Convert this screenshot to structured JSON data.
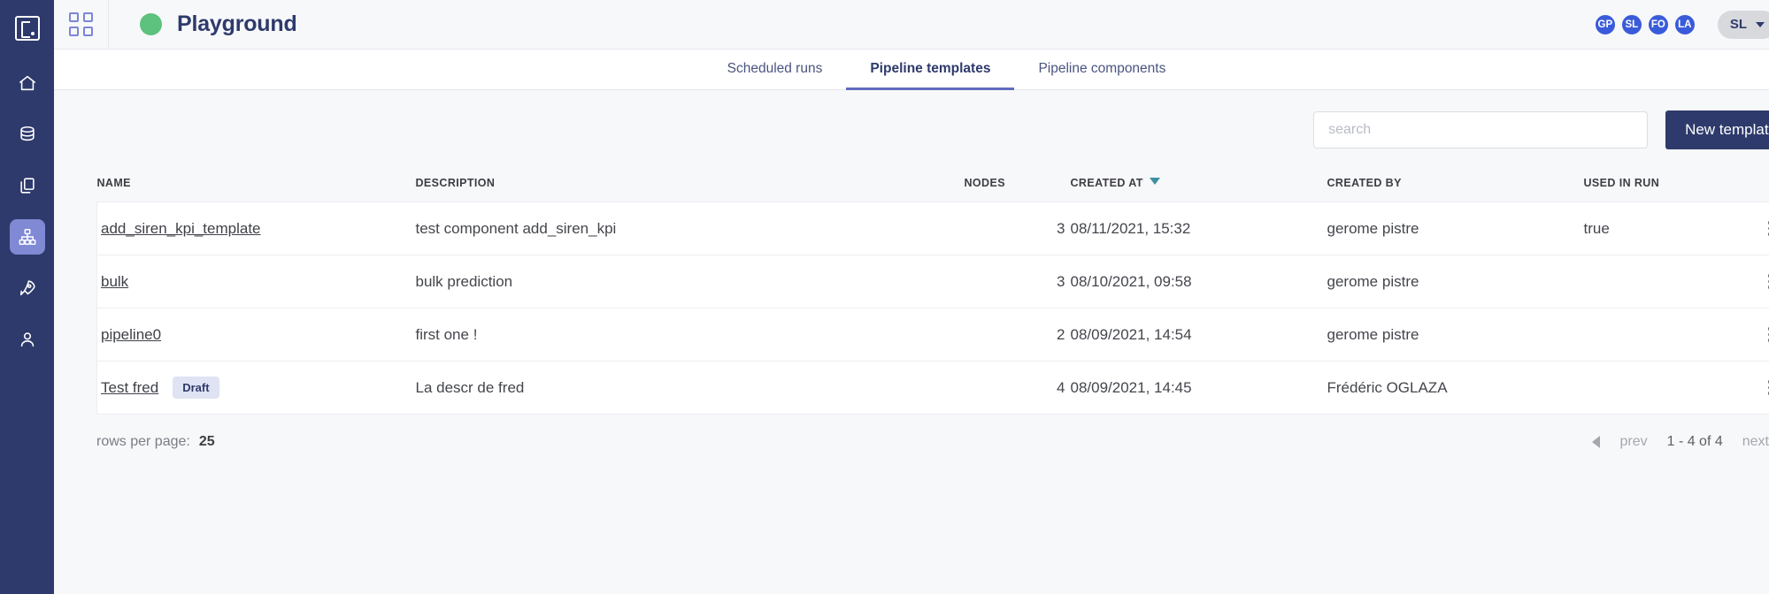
{
  "sidebar": {
    "logo": "previsionio-logo",
    "items": [
      {
        "icon": "home-icon",
        "name": "home",
        "active": false
      },
      {
        "icon": "database-icon",
        "name": "datasources",
        "active": false
      },
      {
        "icon": "copy-documents-icon",
        "name": "experiments",
        "active": false
      },
      {
        "icon": "hierarchy-pipeline-icon",
        "name": "pipelines",
        "active": true
      },
      {
        "icon": "rocket-icon",
        "name": "deployments",
        "active": false
      },
      {
        "icon": "user-icon",
        "name": "users",
        "active": false
      }
    ]
  },
  "topbar": {
    "grid_icon": "app-grid-icon",
    "project_status_color": "#5cc27e",
    "project_name": "Playground",
    "avatars": [
      "GP",
      "SL",
      "FO",
      "LA"
    ],
    "avatar_color": "#3a5bd9",
    "user_menu_label": "SL",
    "settings_icon": "gear-icon"
  },
  "tabs": [
    {
      "label": "Scheduled runs",
      "active": false
    },
    {
      "label": "Pipeline templates",
      "active": true
    },
    {
      "label": "Pipeline components",
      "active": false
    }
  ],
  "toolbar": {
    "search_placeholder": "search",
    "search_value": "",
    "new_template_label": "New template",
    "new_template_color": "#2e3a6b"
  },
  "table": {
    "columns": {
      "name": "NAME",
      "description": "DESCRIPTION",
      "nodes": "NODES",
      "created_at": "CREATED AT",
      "created_by": "CREATED BY",
      "used_in_run": "USED IN RUN"
    },
    "sorted_by": "CREATED AT",
    "sort_direction": "desc",
    "sort_arrow_color": "#3f8fa0",
    "rows": [
      {
        "name": "add_siren_kpi_template",
        "badge": "",
        "description": "test component add_siren_kpi",
        "nodes": "3",
        "created_at": "08/11/2021, 15:32",
        "created_by": "gerome pistre",
        "used_in_run": "true"
      },
      {
        "name": "bulk",
        "badge": "",
        "description": "bulk prediction",
        "nodes": "3",
        "created_at": "08/10/2021, 09:58",
        "created_by": "gerome pistre",
        "used_in_run": ""
      },
      {
        "name": "pipeline0",
        "badge": "",
        "description": "first one !",
        "nodes": "2",
        "created_at": "08/09/2021, 14:54",
        "created_by": "gerome pistre",
        "used_in_run": ""
      },
      {
        "name": "Test fred",
        "badge": "Draft",
        "description": "La descr de fred",
        "nodes": "4",
        "created_at": "08/09/2021, 14:45",
        "created_by": "Frédéric OGLAZA",
        "used_in_run": ""
      }
    ]
  },
  "footer": {
    "rows_per_page_label": "rows per page:",
    "rows_per_page_value": "25",
    "prev_label": "prev",
    "range_label": "1 - 4 of 4",
    "next_label": "next"
  }
}
